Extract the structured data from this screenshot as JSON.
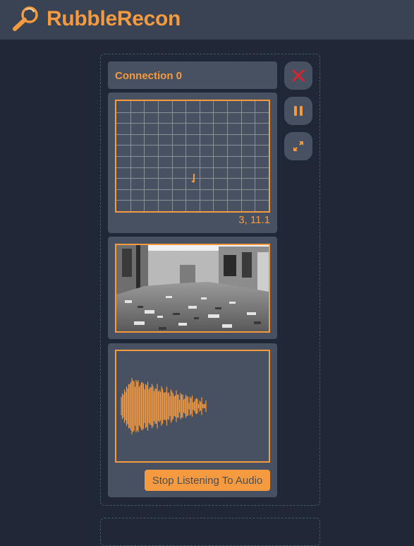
{
  "app": {
    "title": "RubbleRecon",
    "logo_icon": "magnifier-icon",
    "accent_color": "#f59a3e",
    "background_color": "#202838",
    "header_color": "#3a4354",
    "panel_color": "#485161"
  },
  "connection": {
    "title": "Connection 0",
    "map": {
      "coordinates": "3, 11.1",
      "grid_columns": 11,
      "grid_rows": 10
    },
    "camera": {
      "description": "grayscale rubble photo"
    },
    "audio": {
      "button_label": "Stop Listening To Audio"
    }
  },
  "controls": {
    "close_icon": "close-icon",
    "close_color": "#d9252a",
    "pause_icon": "pause-icon",
    "expand_icon": "expand-icon"
  }
}
